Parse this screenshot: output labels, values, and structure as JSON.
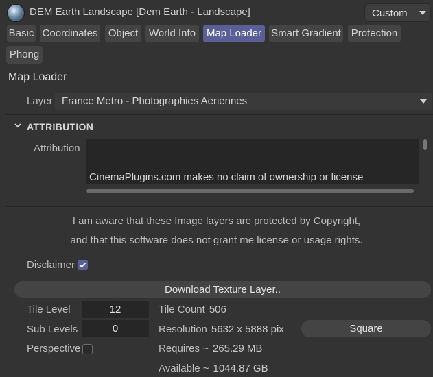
{
  "header": {
    "object_title": "DEM Earth Landscape [Dem Earth - Landscape]",
    "layout_select": "Custom"
  },
  "tabs": [
    "Basic",
    "Coordinates",
    "Object",
    "World Info",
    "Map Loader",
    "Smart Gradient",
    "Protection",
    "Phong"
  ],
  "active_tab": "Map Loader",
  "section_title": "Map Loader",
  "layer": {
    "label": "Layer",
    "value": "France Metro - Photographies Aeriennes"
  },
  "attribution_group": {
    "title": "ATTRIBUTION",
    "label": "Attribution",
    "text": "CinemaPlugins.com makes no claim of ownership or license"
  },
  "notice": {
    "line1": "I am aware that these Image layers are protected by Copyright,",
    "line2": "and that this software does not grant me license or usage rights."
  },
  "disclaimer": {
    "label": "Disclaimer",
    "checked": true
  },
  "download_button": "Download Texture Layer..",
  "tile_level": {
    "label": "Tile Level",
    "value": "12"
  },
  "sub_levels": {
    "label": "Sub Levels",
    "value": "0"
  },
  "perspective": {
    "label": "Perspective",
    "checked": false
  },
  "info": {
    "tile_count_label": "Tile Count",
    "tile_count_value": "506",
    "resolution_label": "Resolution",
    "resolution_value": "5632 x 5888 pix",
    "requires_label": "Requires ~",
    "requires_value": "265.29 MB",
    "available_label": "Available ~",
    "available_value": "1044.87 GB"
  },
  "square_button": "Square",
  "colors": {
    "background": "#333333",
    "accent": "#5a5f98",
    "field": "#262626"
  }
}
